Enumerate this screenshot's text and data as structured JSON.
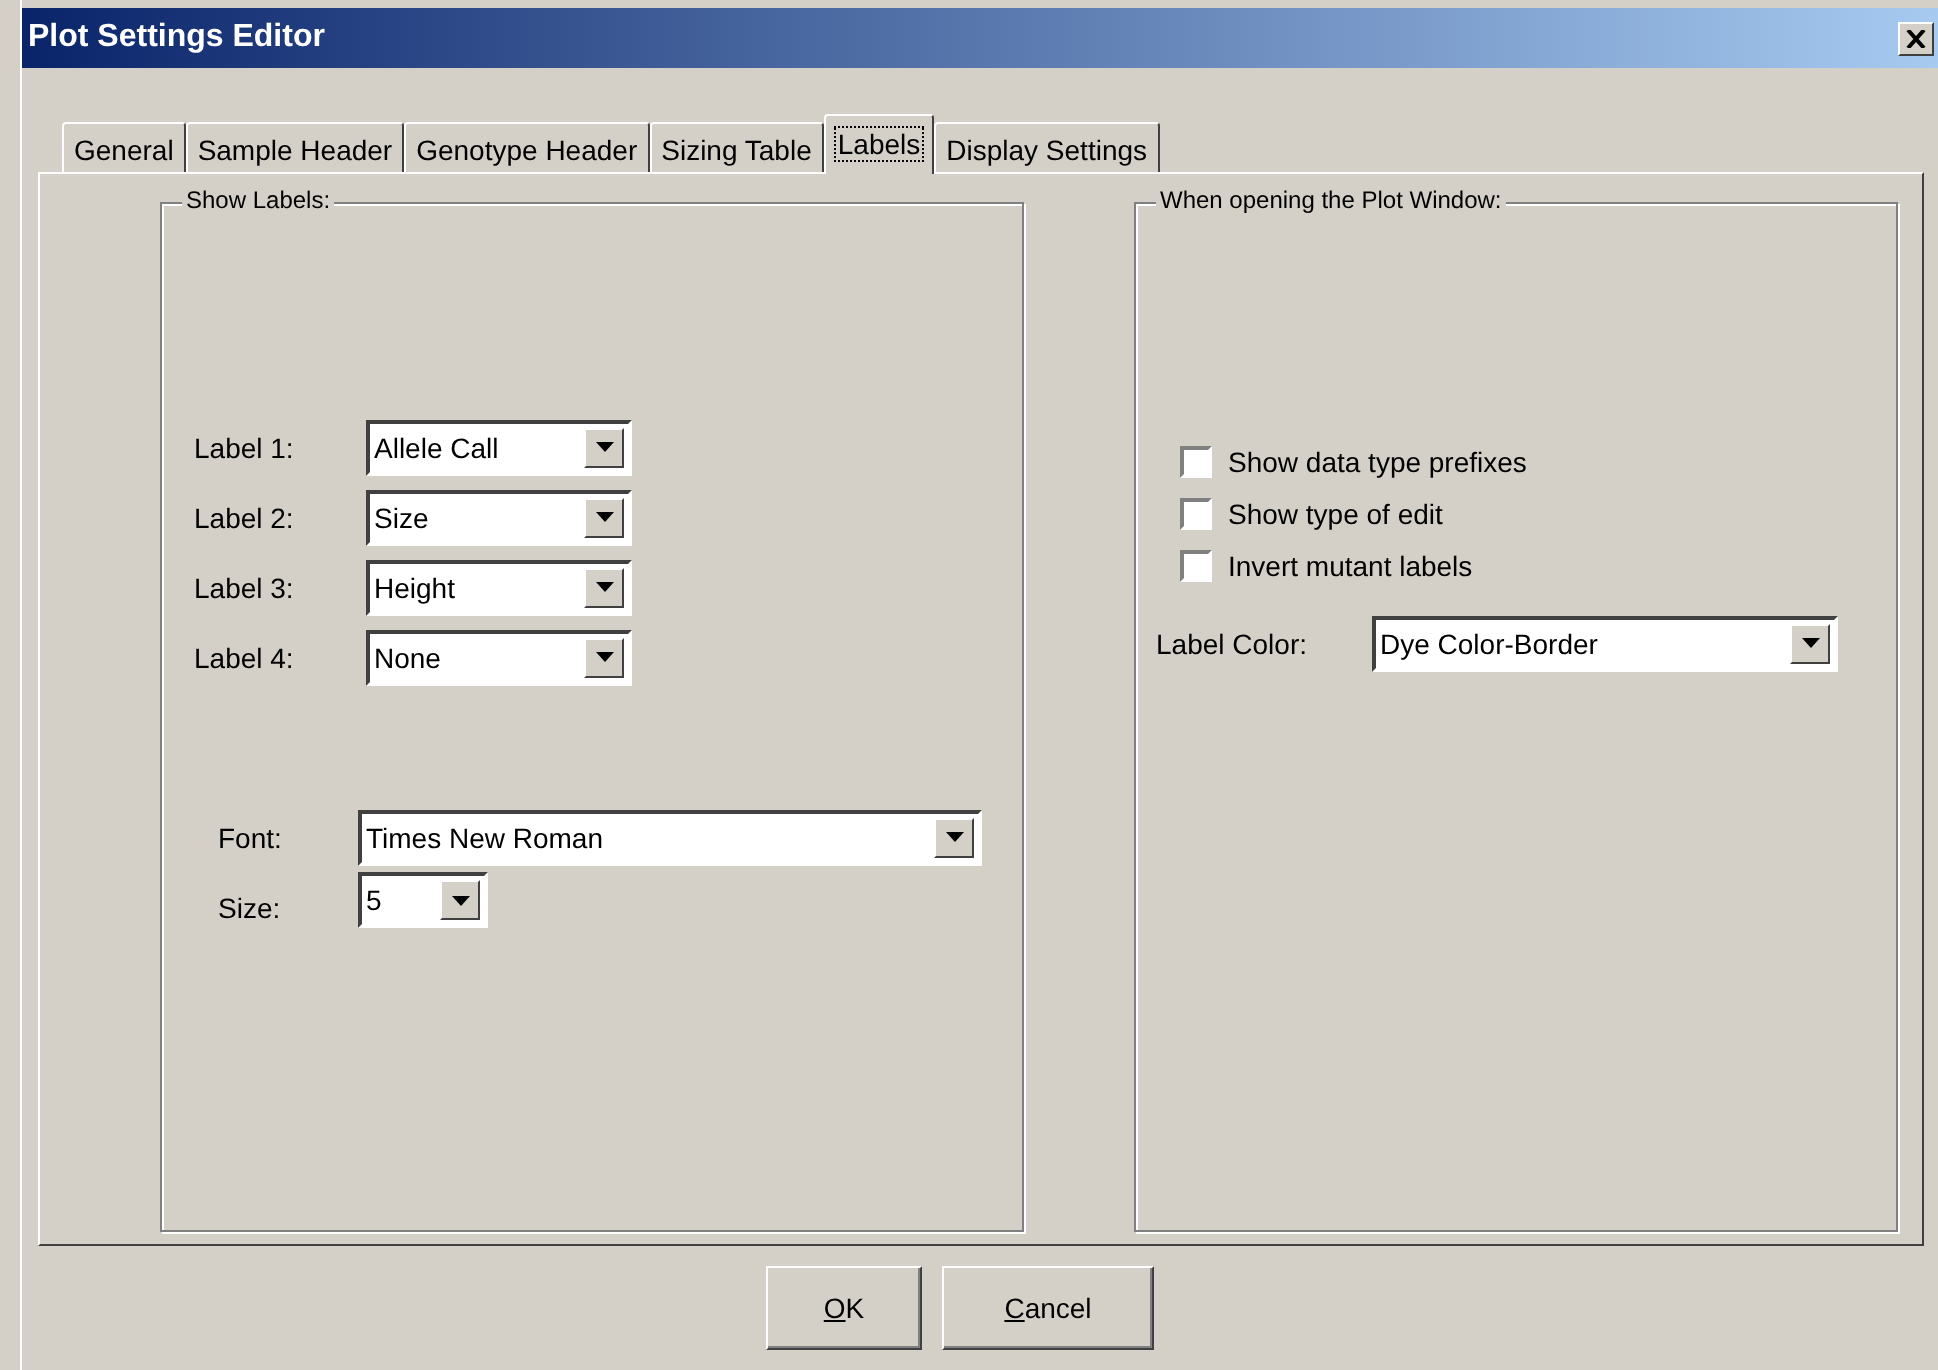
{
  "window": {
    "title": "Plot Settings Editor"
  },
  "tabs": [
    {
      "label": "General",
      "selected": false
    },
    {
      "label": "Sample Header",
      "selected": false
    },
    {
      "label": "Genotype Header",
      "selected": false
    },
    {
      "label": "Sizing Table",
      "selected": false
    },
    {
      "label": "Labels",
      "selected": true
    },
    {
      "label": "Display Settings",
      "selected": false
    }
  ],
  "show_labels": {
    "title": "Show Labels:",
    "labels": [
      {
        "label": "Label 1:",
        "value": "Allele Call"
      },
      {
        "label": "Label 2:",
        "value": "Size"
      },
      {
        "label": "Label 3:",
        "value": "Height"
      },
      {
        "label": "Label 4:",
        "value": "None"
      }
    ],
    "font": {
      "label": "Font:",
      "value": "Times New Roman"
    },
    "size": {
      "label": "Size:",
      "value": "5"
    }
  },
  "plot_window": {
    "title": "When opening the Plot Window:",
    "checkboxes": [
      {
        "label": "Show data type prefixes",
        "checked": false
      },
      {
        "label": "Show type of edit",
        "checked": false
      },
      {
        "label": "Invert mutant labels",
        "checked": false
      }
    ],
    "label_color": {
      "label": "Label Color:",
      "value": "Dye Color-Border"
    }
  },
  "buttons": [
    {
      "label": "OK",
      "first_letter_underlined": true
    },
    {
      "label": "Cancel",
      "first_letter_underlined": true
    }
  ]
}
